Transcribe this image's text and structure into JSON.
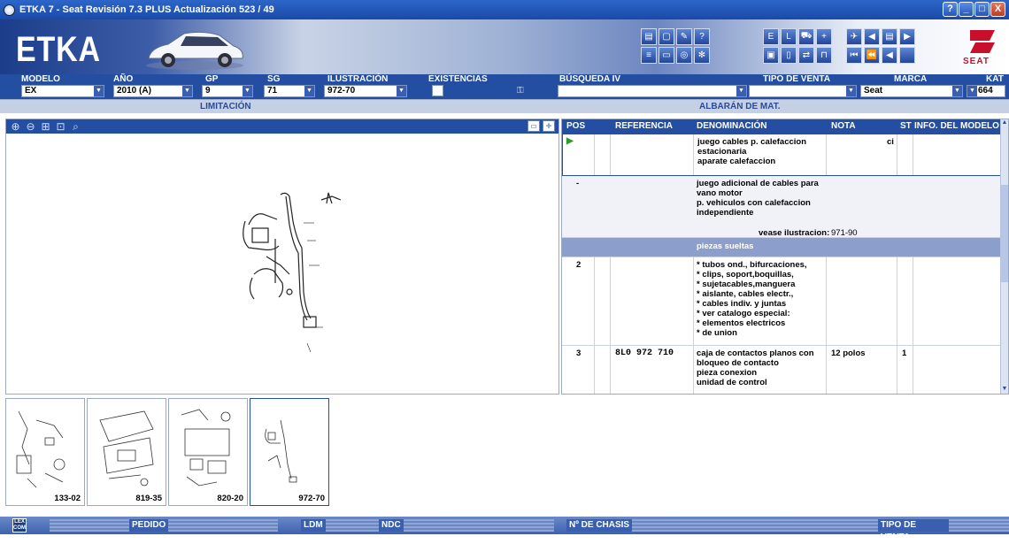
{
  "window": {
    "title": "ETKA 7 - Seat Revisión 7.3 PLUS Actualización 523 / 49",
    "buttons": [
      "?",
      "_",
      "□",
      "X"
    ]
  },
  "header": {
    "logo_text": "ETKA",
    "brand_logo_text": "SEAT"
  },
  "filters": {
    "modelo": {
      "label": "MODELO",
      "value": "EX"
    },
    "anio": {
      "label": "AÑO",
      "value": "2010 (A)"
    },
    "gp": {
      "label": "GP",
      "value": "9"
    },
    "sg": {
      "label": "SG",
      "value": "71"
    },
    "ilustracion": {
      "label": "ILUSTRACIÓN",
      "value": "972-70"
    },
    "existencias": {
      "label": "EXISTENCIAS",
      "checked": false
    },
    "busqueda": {
      "label": "BÚSQUEDA IV",
      "value": ""
    },
    "tipo_venta": {
      "label": "TIPO DE VENTA",
      "value": ""
    },
    "marca": {
      "label": "MARCA",
      "value": "Seat"
    },
    "kat": {
      "label": "KAT",
      "value": "664"
    }
  },
  "subbar": {
    "limitacion": "LIMITACIÓN",
    "albaran": "ALBARÁN DE MAT."
  },
  "table": {
    "headers": {
      "pos": "POS",
      "referencia": "REFERENCIA",
      "denominacion": "DENOMINACIÓN",
      "nota": "NOTA",
      "st": "ST",
      "info": "INFO. DEL MODELO"
    },
    "rows": [
      {
        "pos": "",
        "ref": "",
        "den": "juego cables p. calefaccion\nestacionaria\naparate calefaccion",
        "nota": "ci",
        "st": "",
        "info": ""
      },
      {
        "pos": "-",
        "ref": "",
        "den": "juego adicional de cables para\nvano motor\np. vehiculos con calefaccion\nindependiente",
        "den_extra": "vease ilustracion:",
        "nota": "971-90",
        "st": "",
        "info": ""
      },
      {
        "pos": "",
        "ref": "",
        "den": "piezas sueltas",
        "nota": "",
        "st": "",
        "info": ""
      },
      {
        "pos": "2",
        "ref": "",
        "den": "* tubos ond., bifurcaciones,\n* clips, soport,boquillas,\n* sujetacables,manguera\n* aislante, cables electr.,\n* cables indiv. y juntas\n* ver catalogo especial:\n* elementos electricos\n* de union",
        "nota": "",
        "st": "",
        "info": ""
      },
      {
        "pos": "3",
        "ref": "8L0 972 710",
        "den": "caja de contactos planos con\nbloqueo de contacto\npieza conexion\nunidad de control",
        "nota": "12 polos",
        "st": "1",
        "info": ""
      }
    ]
  },
  "thumbnails": [
    {
      "label": "133-02"
    },
    {
      "label": "819-35"
    },
    {
      "label": "820-20"
    },
    {
      "label": "972-70"
    }
  ],
  "statusbar": {
    "lex_icon": "LEX COM",
    "pedido": "PEDIDO",
    "ldm": "LDM",
    "ndc": "NDC",
    "chasis": "Nº DE CHASIS",
    "tipo_venta": "TIPO DE VENTA"
  }
}
